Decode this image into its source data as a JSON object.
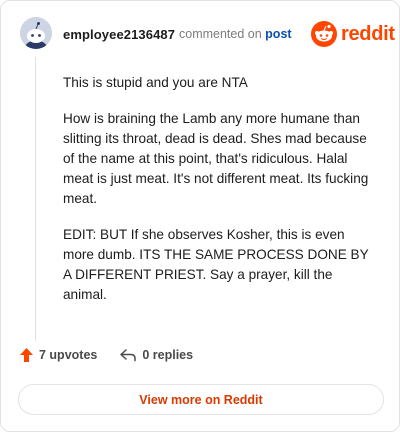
{
  "header": {
    "username": "employee2136487",
    "action_text": "commented on",
    "target_link": "post",
    "brand": "reddit"
  },
  "comment": {
    "paragraphs": [
      "This is stupid and you are NTA",
      "How is braining the Lamb any more humane than slitting its throat, dead is dead. Shes mad because of the name at this point, that's ridiculous. Halal meat is just meat. It's not different meat. Its fucking meat.",
      "EDIT: BUT If she observes Kosher, this is even more dumb. ITS THE SAME PROCESS DONE BY A DIFFERENT PRIEST. Say a prayer, kill the animal."
    ]
  },
  "actions": {
    "upvotes": "7 upvotes",
    "replies": "0 replies"
  },
  "footer": {
    "view_more": "View more on Reddit"
  },
  "colors": {
    "brand": "#ff4500",
    "upvote": "#ff4500",
    "link": "#0a4fb4",
    "view_more": "#d93a00"
  },
  "icons": {
    "avatar": "snoo-avatar",
    "logo": "reddit-alien-icon",
    "upvote": "upvote-arrow-icon",
    "reply": "reply-arrow-icon"
  }
}
